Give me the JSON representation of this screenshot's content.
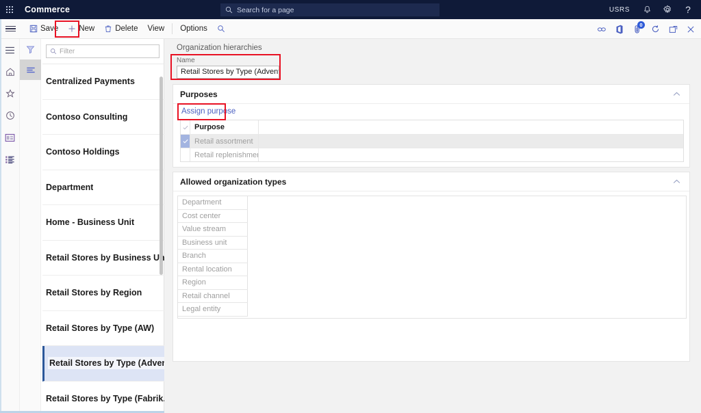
{
  "topbar": {
    "waffle_icon": "app-launcher-icon",
    "brand": "Commerce",
    "search": {
      "icon": "search-icon",
      "placeholder": "Search for a page"
    },
    "user_initials": "USRS",
    "icons": [
      {
        "name": "notifications-bell-icon",
        "glyph": "bell"
      },
      {
        "name": "settings-gear-icon",
        "glyph": "gear"
      },
      {
        "name": "help-question-icon",
        "glyph": "?"
      }
    ]
  },
  "commandbar": {
    "menu_icon": "hamburger-menu-icon",
    "buttons": [
      {
        "name": "save-button",
        "label": "Save",
        "icon": "save-disk-icon",
        "highlighted": false
      },
      {
        "name": "new-button",
        "label": "New",
        "icon": "plus-icon",
        "highlighted": true
      },
      {
        "name": "delete-button",
        "label": "Delete",
        "icon": "trash-icon",
        "highlighted": false
      },
      {
        "name": "view-button",
        "label": "View",
        "icon": "",
        "highlighted": false
      },
      {
        "name": "options-button",
        "label": "Options",
        "icon": "",
        "highlighted": false
      }
    ],
    "search_icon": "search-icon",
    "right_icons": [
      {
        "name": "share-link-icon",
        "badge": ""
      },
      {
        "name": "office-app-icon",
        "badge": ""
      },
      {
        "name": "attachments-icon",
        "badge": "0"
      },
      {
        "name": "refresh-icon",
        "badge": ""
      },
      {
        "name": "popout-window-icon",
        "badge": ""
      },
      {
        "name": "close-icon",
        "badge": ""
      }
    ]
  },
  "leftrail": {
    "items": [
      {
        "name": "nav-expand-icon",
        "glyph": "hamburger"
      },
      {
        "name": "home-icon",
        "glyph": "home"
      },
      {
        "name": "favorites-star-icon",
        "glyph": "star"
      },
      {
        "name": "recent-clock-icon",
        "glyph": "clock"
      },
      {
        "name": "workspaces-icon",
        "glyph": "workspace"
      },
      {
        "name": "modules-list-icon",
        "glyph": "list"
      }
    ]
  },
  "listpanel": {
    "tools": [
      {
        "name": "filter-funnel-icon",
        "active": false
      },
      {
        "name": "list-details-icon",
        "active": true
      }
    ],
    "filter": {
      "icon": "search-icon",
      "placeholder": "Filter",
      "value": ""
    },
    "records": [
      {
        "label": "Centralized Payments",
        "selected": false
      },
      {
        "label": "Contoso Consulting",
        "selected": false
      },
      {
        "label": "Contoso Holdings",
        "selected": false
      },
      {
        "label": "Department",
        "selected": false
      },
      {
        "label": "Home - Business Unit",
        "selected": false
      },
      {
        "label": "Retail Stores by Business Unit",
        "selected": false
      },
      {
        "label": "Retail Stores by Region",
        "selected": false
      },
      {
        "label": "Retail Stores by Type (AW)",
        "selected": false
      },
      {
        "label": "Retail Stores by Type (Advent",
        "selected": true
      },
      {
        "label": "Retail Stores by Type (Fabrik..",
        "selected": false
      }
    ]
  },
  "content": {
    "breadcrumb": "Organization hierarchies",
    "name_field": {
      "label": "Name",
      "value": "Retail Stores by Type (Adventur...",
      "highlighted": true
    },
    "purposes": {
      "title": "Purposes",
      "collapse_icon": "chevron-up-icon",
      "assign_link": "Assign purpose",
      "assign_link_highlighted": true,
      "grid": {
        "header": {
          "check_icon": "checkmark-icon",
          "column": "Purpose"
        },
        "rows": [
          {
            "label": "Retail assortment",
            "checked": true,
            "selected": true
          },
          {
            "label": "Retail replenishment",
            "checked": false,
            "selected": false
          }
        ]
      }
    },
    "allowed_types": {
      "title": "Allowed organization types",
      "collapse_icon": "chevron-up-icon",
      "rows": [
        "Department",
        "Cost center",
        "Value stream",
        "Business unit",
        "Branch",
        "Rental location",
        "Region",
        "Retail channel",
        "Legal entity"
      ]
    }
  },
  "colors": {
    "topbar_bg": "#0f1a38",
    "accent_link": "#4a5fc1",
    "highlight_red": "#e81123",
    "selected_row_bg": "#dde4f5",
    "selected_row_border": "#2b579a",
    "checkbox_on": "#a3b4e0"
  }
}
